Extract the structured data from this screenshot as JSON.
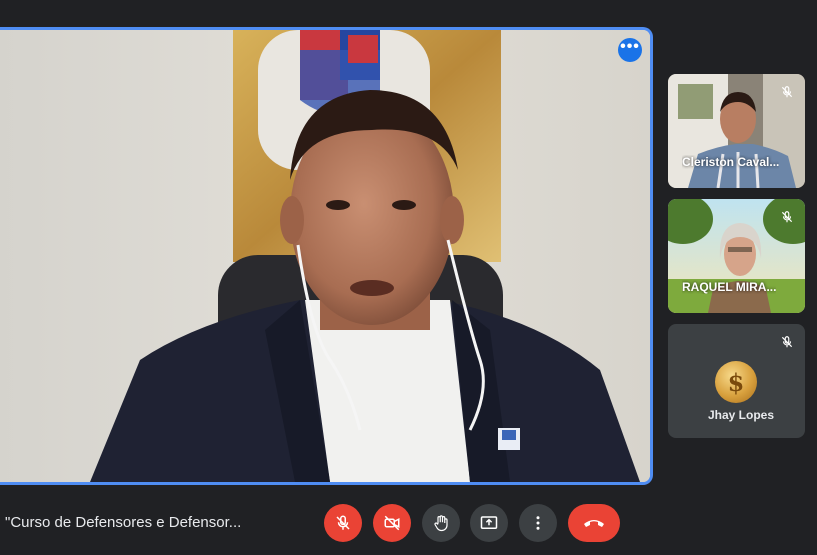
{
  "participants": {
    "tile1_name": "Cleriston Caval...",
    "tile2_name": "RAQUEL MIRA...",
    "tile3_name": "Jhay Lopes",
    "tile3_avatar_glyph": "$"
  },
  "meeting": {
    "title": "\"Curso de Defensores e Defensor..."
  },
  "icons": {
    "more": "more-options-icon",
    "mic_off": "mic-off-icon",
    "cam_off": "camera-off-icon",
    "hand": "raise-hand-icon",
    "present": "present-screen-icon",
    "more_vert": "more-vert-icon",
    "hangup": "hang-up-icon"
  },
  "colors": {
    "accent": "#1a73e8",
    "active_border": "#4f8df3",
    "danger": "#ea4335",
    "control_bg": "#3c4043",
    "background": "#202124"
  }
}
